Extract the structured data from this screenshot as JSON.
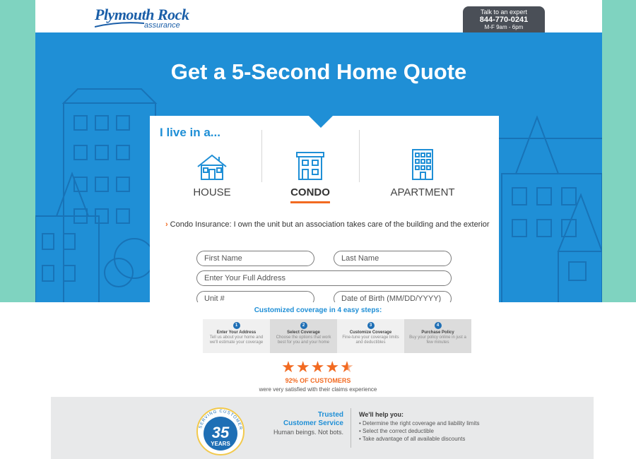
{
  "brand": {
    "name": "Plymouth Rock",
    "sub": "assurance",
    "color": "#1a5ea8"
  },
  "expert": {
    "line1": "Talk to an expert",
    "phone": "844-770-0241",
    "hours": "M-F  9am - 6pm"
  },
  "hero": {
    "title": "Get a 5-Second Home Quote",
    "bg_color": "#1f8fd6"
  },
  "selector": {
    "heading": "I live in a...",
    "options": [
      {
        "label": "HOUSE",
        "icon": "house-icon",
        "selected": false
      },
      {
        "label": "CONDO",
        "icon": "condo-icon",
        "selected": true
      },
      {
        "label": "APARTMENT",
        "icon": "apartment-icon",
        "selected": false
      }
    ],
    "accent": "#f26a21"
  },
  "description": "Condo Insurance: I own the unit but an association takes care of the building and the exterior",
  "form": {
    "first_name": "First Name",
    "last_name": "Last Name",
    "address": "Enter Your Full Address",
    "unit": "Unit #",
    "dob": "Date of Birth (MM/DD/YYYY)"
  },
  "steps": {
    "title": "Customized coverage in 4 easy steps:",
    "items": [
      {
        "num": "1",
        "title": "Enter Your Address",
        "desc": "Tell us about your home and we'll estimate your coverage"
      },
      {
        "num": "2",
        "title": "Select Coverage",
        "desc": "Choose the options that work best for you and your home"
      },
      {
        "num": "3",
        "title": "Customize Coverage",
        "desc": "Fine-tune your coverage limits and deductibles"
      },
      {
        "num": "4",
        "title": "Purchase Policy",
        "desc": "Buy your policy online in just a few minutes"
      }
    ]
  },
  "rating": {
    "stars": 4.5,
    "headline": "92% OF CUSTOMERS",
    "sub": "were very satisfied with their claims experience"
  },
  "footer": {
    "badge_ring": "SERVING CUSTOMERS FOR OVER",
    "badge_number": "35",
    "badge_unit": "YEARS",
    "trusted_1": "Trusted",
    "trusted_2": "Customer Service",
    "human": "Human beings. Not bots.",
    "help_title": "We'll help you:",
    "help_items": [
      "Determine the right coverage and liability limits",
      "Select the correct deductible",
      "Take advantage of all available discounts"
    ]
  }
}
